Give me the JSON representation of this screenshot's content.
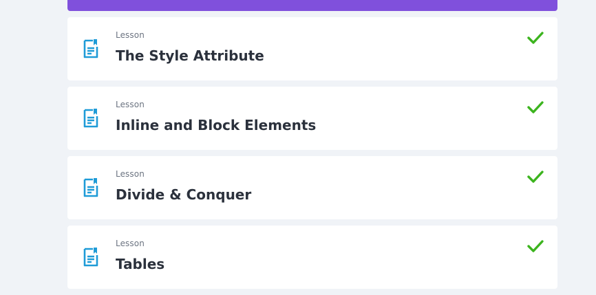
{
  "colors": {
    "accent": "#8050dc",
    "icon": "#1e9bd7",
    "check": "#3cb41e",
    "background": "#f0f3f7",
    "card": "#ffffff"
  },
  "lessons": [
    {
      "kind": "Lesson",
      "title": "The Style Attribute",
      "icon": "document-icon",
      "completed": true
    },
    {
      "kind": "Lesson",
      "title": "Inline and Block Elements",
      "icon": "document-icon",
      "completed": true
    },
    {
      "kind": "Lesson",
      "title": "Divide & Conquer",
      "icon": "document-icon",
      "completed": true
    },
    {
      "kind": "Lesson",
      "title": "Tables",
      "icon": "document-icon",
      "completed": true
    }
  ]
}
